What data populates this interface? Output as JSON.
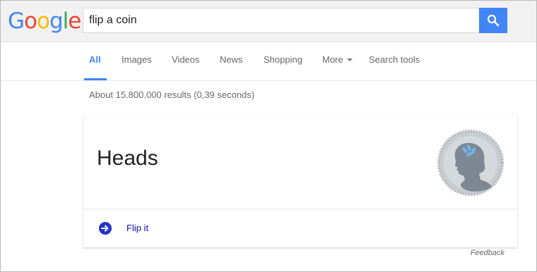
{
  "logo": {
    "g1": "G",
    "o1": "o",
    "o2": "o",
    "g2": "g",
    "l": "l",
    "e": "e"
  },
  "search": {
    "value": "flip a coin",
    "button_icon": "search-icon"
  },
  "tabs": [
    {
      "label": "All",
      "active": true
    },
    {
      "label": "Images"
    },
    {
      "label": "Videos"
    },
    {
      "label": "News"
    },
    {
      "label": "Shopping"
    },
    {
      "label": "More"
    },
    {
      "label": "Search tools"
    }
  ],
  "result_stats": "About 15.800.000 results (0,39 seconds)",
  "card": {
    "result": "Heads",
    "coin_icon": "coin-heads-icon",
    "flip_icon": "arrow-right-circle-icon",
    "flip_label": "Flip it"
  },
  "feedback": "Feedback",
  "colors": {
    "accent": "#4285f4",
    "link": "#1a0dab",
    "flip_icon": "#2233cc",
    "coin": "#8f9ba6"
  }
}
